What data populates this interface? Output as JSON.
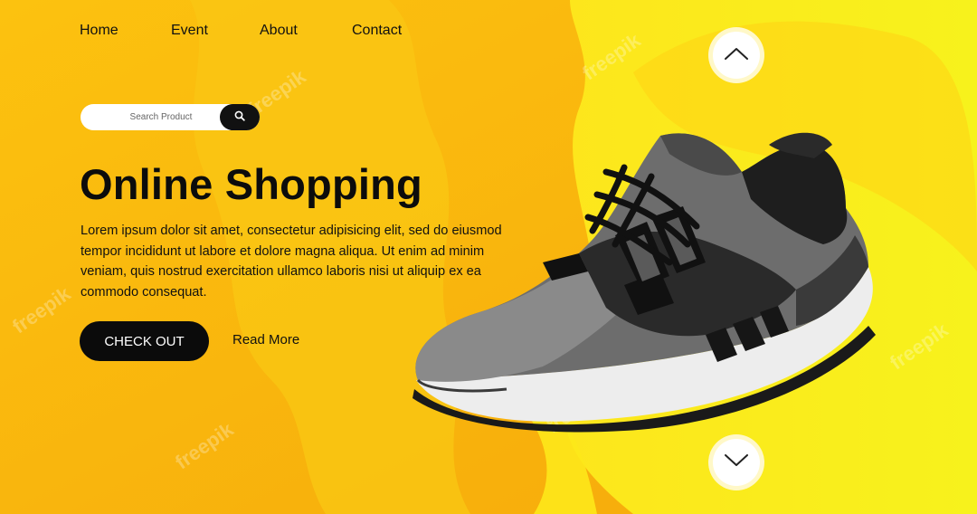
{
  "nav": {
    "items": [
      "Home",
      "Event",
      "About",
      "Contact"
    ]
  },
  "search": {
    "placeholder": "Search Product",
    "button_icon": "search-icon"
  },
  "hero": {
    "title": "Online Shopping",
    "description": "Lorem ipsum dolor sit amet, consectetur adipisicing elit, sed do eiusmod tempor incididunt ut labore et dolore magna aliqua. Ut enim ad minim veniam, quis nostrud exercitation ullamco laboris nisi ut aliquip ex ea commodo consequat.",
    "primary_button": "CHECK OUT",
    "secondary_link": "Read More"
  },
  "carousel": {
    "up_icon": "chevron-up-icon",
    "down_icon": "chevron-down-icon"
  },
  "watermark": "freepik",
  "colors": {
    "background": "#f9b70c",
    "accent_light": "#fde81a",
    "button_dark": "#0b0b0b",
    "text": "#111111"
  }
}
